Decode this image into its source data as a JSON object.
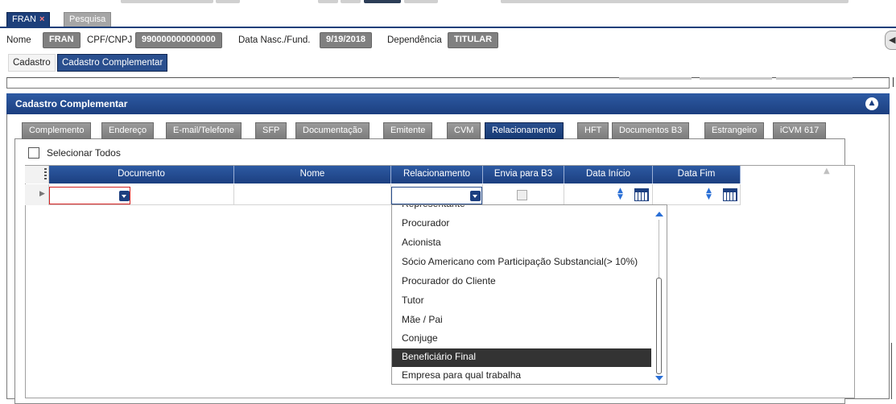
{
  "doc_tabs": [
    {
      "label": "FRAN",
      "close": "×",
      "active": true
    },
    {
      "label": "Pesquisa",
      "active": false
    }
  ],
  "header": {
    "nome_label": "Nome",
    "nome_value": "FRAN",
    "cpf_label": "CPF/CNPJ",
    "cpf_value": "990000000000000",
    "data_label": "Data Nasc./Fund.",
    "data_value": "9/19/2018",
    "dep_label": "Dependência",
    "dep_value": "TITULAR"
  },
  "sub_tabs": [
    "Cadastro",
    "Cadastro Complementar"
  ],
  "panel": {
    "title": "Cadastro Complementar"
  },
  "inner_tabs": [
    "Complemento",
    "Endereço",
    "E-mail/Telefone",
    "SFP",
    "Documentação",
    "Emitente",
    "CVM",
    "Relacionamento",
    "HFT",
    "Documentos B3",
    "Estrangeiro",
    "iCVM 617"
  ],
  "selected_inner_tab": "Relacionamento",
  "select_all_label": "Selecionar Todos",
  "grid": {
    "columns": [
      "Documento",
      "Nome",
      "Relacionamento",
      "Envia para B3",
      "Data Início",
      "Data Fim"
    ],
    "row": {
      "documento": "",
      "nome": "",
      "relacionamento": "",
      "envia_b3": false,
      "data_inicio": "",
      "data_fim": ""
    }
  },
  "dropdown": {
    "items": [
      "Representante",
      "Procurador",
      "Acionista",
      "Sócio Americano com Participação Substancial(> 10%)",
      "Procurador do Cliente",
      "Tutor",
      "Mãe / Pai",
      "Conjuge",
      "Beneficiário Final",
      "Empresa para qual trabalha"
    ],
    "highlighted": "Beneficiário Final"
  },
  "colors": {
    "accent": "#1c3f80",
    "highlight_bg": "#333333",
    "error_border": "#d42020"
  }
}
